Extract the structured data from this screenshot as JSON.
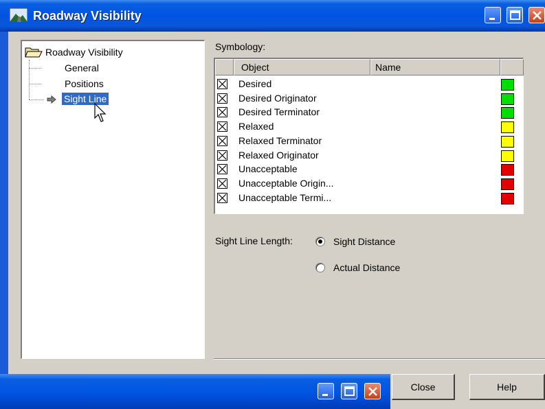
{
  "window": {
    "title": "Roadway Visibility"
  },
  "tree": {
    "root": "Roadway Visibility",
    "items": [
      "General",
      "Positions",
      "Sight Line"
    ],
    "selected": "Sight Line"
  },
  "symbology": {
    "label": "Symbology:",
    "columns": [
      "Object",
      "Name"
    ],
    "rows": [
      {
        "object": "Desired",
        "checked": true,
        "color": "#00dd00"
      },
      {
        "object": "Desired Originator",
        "checked": true,
        "color": "#00dd00"
      },
      {
        "object": "Desired Terminator",
        "checked": true,
        "color": "#00dd00"
      },
      {
        "object": "Relaxed",
        "checked": true,
        "color": "#ffff00"
      },
      {
        "object": "Relaxed Terminator",
        "checked": true,
        "color": "#ffff00"
      },
      {
        "object": "Relaxed Originator",
        "checked": true,
        "color": "#ffff00"
      },
      {
        "object": "Unacceptable",
        "checked": true,
        "color": "#e00000"
      },
      {
        "object": "Unacceptable Origin...",
        "checked": true,
        "color": "#e00000"
      },
      {
        "object": "Unacceptable Termi...",
        "checked": true,
        "color": "#e00000"
      }
    ]
  },
  "sight_line_length": {
    "label": "Sight Line Length:",
    "options": [
      "Sight Distance",
      "Actual Distance"
    ],
    "selected": "Sight Distance"
  },
  "buttons": {
    "close": "Close",
    "help": "Help"
  }
}
